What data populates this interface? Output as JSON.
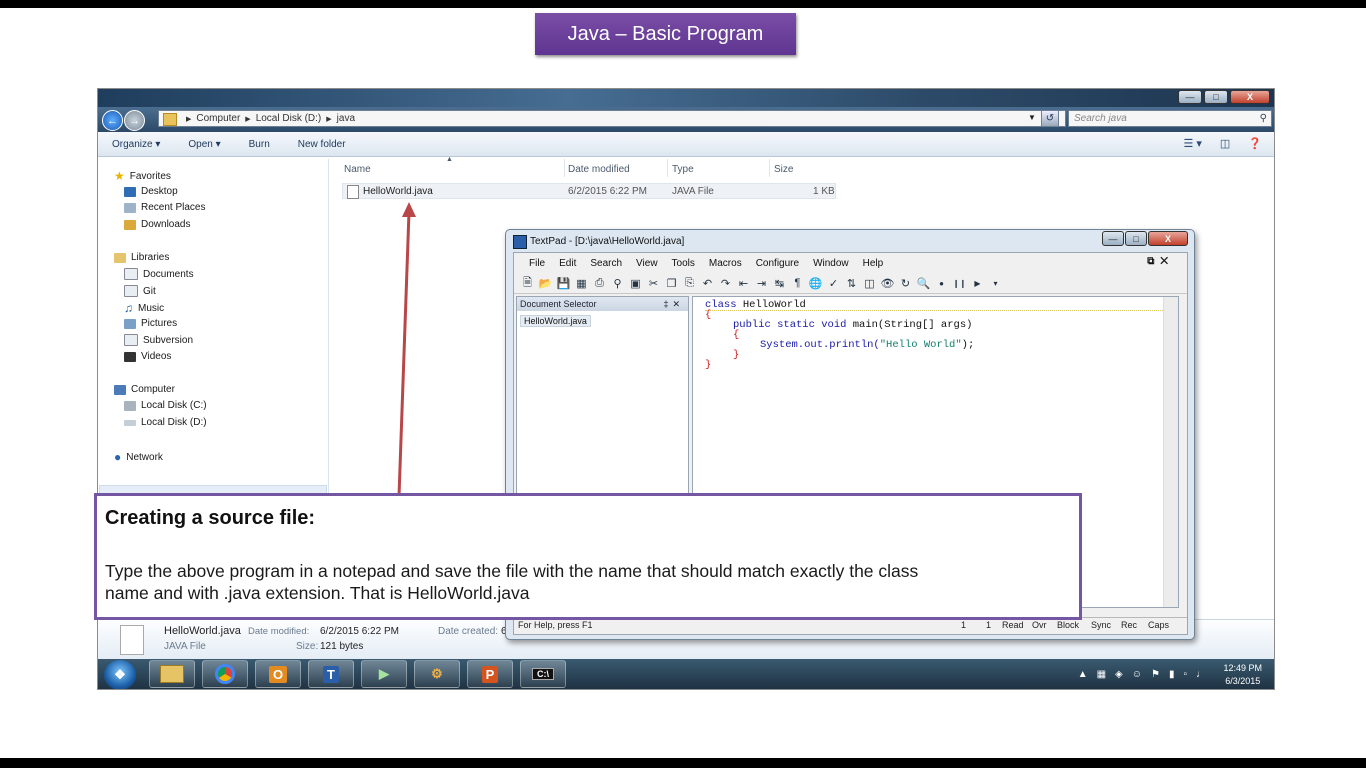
{
  "slide_title": "Java – Basic Program",
  "explorer": {
    "breadcrumb": [
      "Computer",
      "Local Disk (D:)",
      "java"
    ],
    "search_placeholder": "Search java",
    "commands": [
      "Organize ▾",
      "Open ▾",
      "Burn",
      "New folder"
    ],
    "nav": {
      "favorites": "Favorites",
      "desktop": "Desktop",
      "recent": "Recent Places",
      "downloads": "Downloads",
      "libraries": "Libraries",
      "documents": "Documents",
      "git": "Git",
      "music": "Music",
      "pictures": "Pictures",
      "subversion": "Subversion",
      "videos": "Videos",
      "computer": "Computer",
      "disk_c": "Local Disk (C:)",
      "disk_d": "Local Disk (D:)",
      "network": "Network"
    },
    "columns": [
      "Name",
      "Date modified",
      "Type",
      "Size"
    ],
    "file": {
      "name": "HelloWorld.java",
      "date": "6/2/2015 6:22 PM",
      "type": "JAVA File",
      "size": "1 KB"
    },
    "details": {
      "name": "HelloWorld.java",
      "modified_label": "Date modified:",
      "modified": "6/2/2015 6:22 PM",
      "created_label": "Date created:",
      "created": "6",
      "type": "JAVA File",
      "size_label": "Size:",
      "size": "121 bytes"
    }
  },
  "textpad": {
    "title": "TextPad - [D:\\java\\HelloWorld.java]",
    "menus": [
      "File",
      "Edit",
      "Search",
      "View",
      "Tools",
      "Macros",
      "Configure",
      "Window",
      "Help"
    ],
    "doc_selector_title": "Document Selector",
    "doc_item": "HelloWorld.java",
    "code": {
      "l1_kw": "class",
      "l1_name": " HelloWorld",
      "l2": "{",
      "l3_kw": "public static void",
      "l3_rest": " main(String[] args)",
      "l4": "{",
      "l5_a": "System.out.println(",
      "l5_str": "\"Hello World\"",
      "l5_b": ");",
      "l6": "}",
      "l7": "}"
    },
    "status": {
      "help": "For Help, press F1",
      "line": "1",
      "col": "1",
      "read": "Read",
      "ovr": "Ovr",
      "block": "Block",
      "sync": "Sync",
      "rec": "Rec",
      "caps": "Caps"
    }
  },
  "taskbar": {
    "clock_time": "12:49 PM",
    "clock_date": "6/3/2015"
  },
  "callout": {
    "heading": "Creating a source file:",
    "line1": "Type the above program in a notepad and save the file with the name that should match exactly the class",
    "line2": "name and with .java extension. That is HelloWorld.java"
  },
  "colors": {
    "accent": "#6a4299",
    "callout_border": "#7556a3",
    "arrow": "#b8474a"
  }
}
